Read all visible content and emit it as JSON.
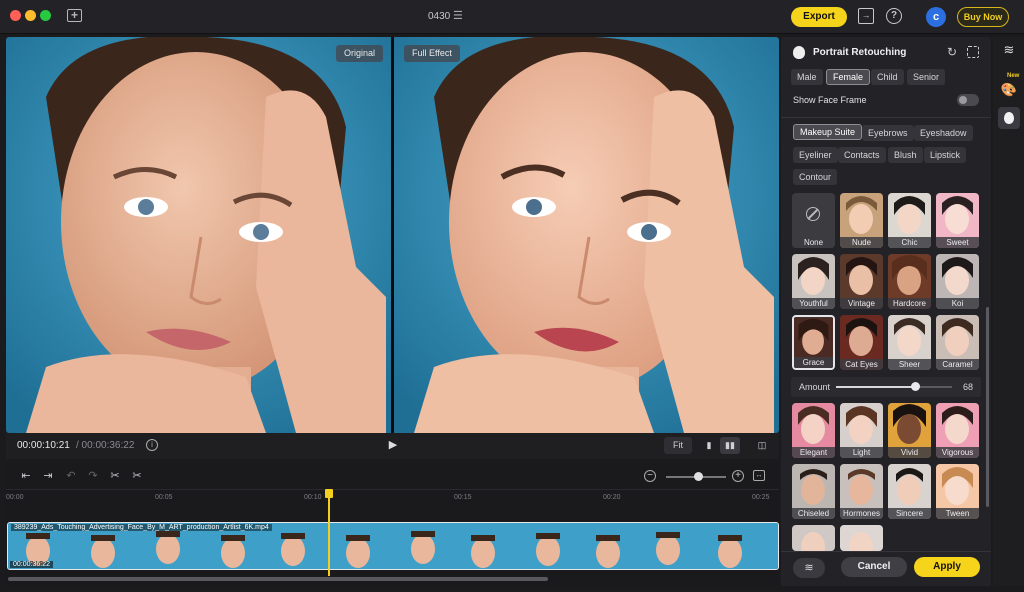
{
  "titlebar": {
    "project_title": "0430",
    "export_label": "Export",
    "avatar_letter": "c",
    "buy_now_label": "Buy Now"
  },
  "preview": {
    "original_label": "Original",
    "full_effect_label": "Full Effect"
  },
  "playback": {
    "current_time": "00:00:10:21",
    "total_time": "/ 00:00:36:22",
    "fit_label": "Fit"
  },
  "timeline": {
    "ruler_labels": [
      "00:00",
      "00:05",
      "00:10",
      "00:15",
      "00:20",
      "00:25"
    ],
    "clip_name": "389239_Ads_Touching_Advertising_Face_By_M_ART_production_Artlist_6K.mp4",
    "clip_duration": "00:00:36:22"
  },
  "panel": {
    "title": "Portrait Retouching",
    "subjects": [
      "Male",
      "Female",
      "Child",
      "Senior"
    ],
    "active_subject": "Female",
    "show_face_frame_label": "Show Face Frame",
    "show_face_frame": false,
    "categories": [
      "Makeup Suite",
      "Eyebrows",
      "Eyeshadow",
      "Eyeliner",
      "Contacts",
      "Blush",
      "Lipstick",
      "Contour"
    ],
    "active_category": "Makeup Suite",
    "looks_row1": [
      "None",
      "Nude",
      "Chic",
      "Sweet"
    ],
    "looks_row2": [
      "Youthful",
      "Vintage",
      "Hardcore",
      "Koi"
    ],
    "looks_row3": [
      "Grace",
      "Cat Eyes",
      "Sheer",
      "Caramel"
    ],
    "selected_look": "Grace",
    "amount_label": "Amount",
    "amount_value": "68",
    "styles_row1": [
      "Elegant",
      "Light",
      "Vivid",
      "Vigorous"
    ],
    "styles_row2": [
      "Chiseled",
      "Hormones",
      "Sincere",
      "Tween"
    ],
    "cancel_label": "Cancel",
    "apply_label": "Apply"
  },
  "rail": {
    "new_badge": "New"
  },
  "colors": {
    "accent": "#f6d41c",
    "background": "#1b1b1e",
    "panel": "#232327"
  }
}
